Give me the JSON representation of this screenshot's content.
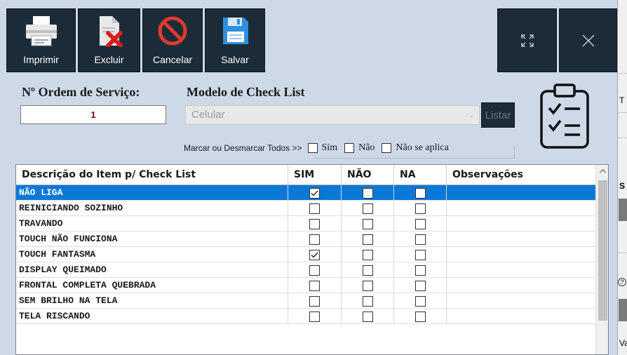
{
  "toolbar": {
    "imprimir_label": "Imprimir",
    "excluir_label": "Excluir",
    "cancelar_label": "Cancelar",
    "salvar_label": "Salvar"
  },
  "form": {
    "ordem_label": "Nº Ordem de Serviço:",
    "ordem_value": "1",
    "modelo_label": "Modelo de Check List",
    "modelo_value": "Celular",
    "listar_label": "Listar",
    "marcar_label": "Marcar ou Desmarcar Todos >>",
    "marcar_sim": "Sim",
    "marcar_nao": "Não",
    "marcar_na": "Não se aplica"
  },
  "grid": {
    "columns": [
      "Descrição do Item p/ Check List",
      "SIM",
      "NÃO",
      "NA",
      "Observações"
    ],
    "rows": [
      {
        "descricao": "NÃO LIGA",
        "sim": true,
        "nao": false,
        "na": false,
        "obs": "",
        "selected": true
      },
      {
        "descricao": "REINICIANDO SOZINHO",
        "sim": false,
        "nao": false,
        "na": false,
        "obs": "",
        "selected": false
      },
      {
        "descricao": "TRAVANDO",
        "sim": false,
        "nao": false,
        "na": false,
        "obs": "",
        "selected": false
      },
      {
        "descricao": "TOUCH NÃO FUNCIONA",
        "sim": false,
        "nao": false,
        "na": false,
        "obs": "",
        "selected": false
      },
      {
        "descricao": "TOUCH FANTASMA",
        "sim": true,
        "nao": false,
        "na": false,
        "obs": "",
        "selected": false
      },
      {
        "descricao": "DISPLAY QUEIMADO",
        "sim": false,
        "nao": false,
        "na": false,
        "obs": "",
        "selected": false
      },
      {
        "descricao": "FRONTAL COMPLETA QUEBRADA",
        "sim": false,
        "nao": false,
        "na": false,
        "obs": "",
        "selected": false
      },
      {
        "descricao": "SEM BRILHO NA TELA",
        "sim": false,
        "nao": false,
        "na": false,
        "obs": "",
        "selected": false
      },
      {
        "descricao": "TELA RISCANDO",
        "sim": false,
        "nao": false,
        "na": false,
        "obs": "",
        "selected": false
      }
    ]
  },
  "right_strip": {
    "t_label": "T",
    "s_label": "S",
    "help_label": "?",
    "va_label": "Va"
  },
  "colors": {
    "toolbar_bg": "#1c2b38",
    "window_bg": "#cdd9e6",
    "selection": "#0b78d7",
    "ordem_value": "#800000",
    "excluir_red": "#d91e1e",
    "cancelar_red": "#e23b2e",
    "salvar_blue": "#2f8fe0"
  }
}
